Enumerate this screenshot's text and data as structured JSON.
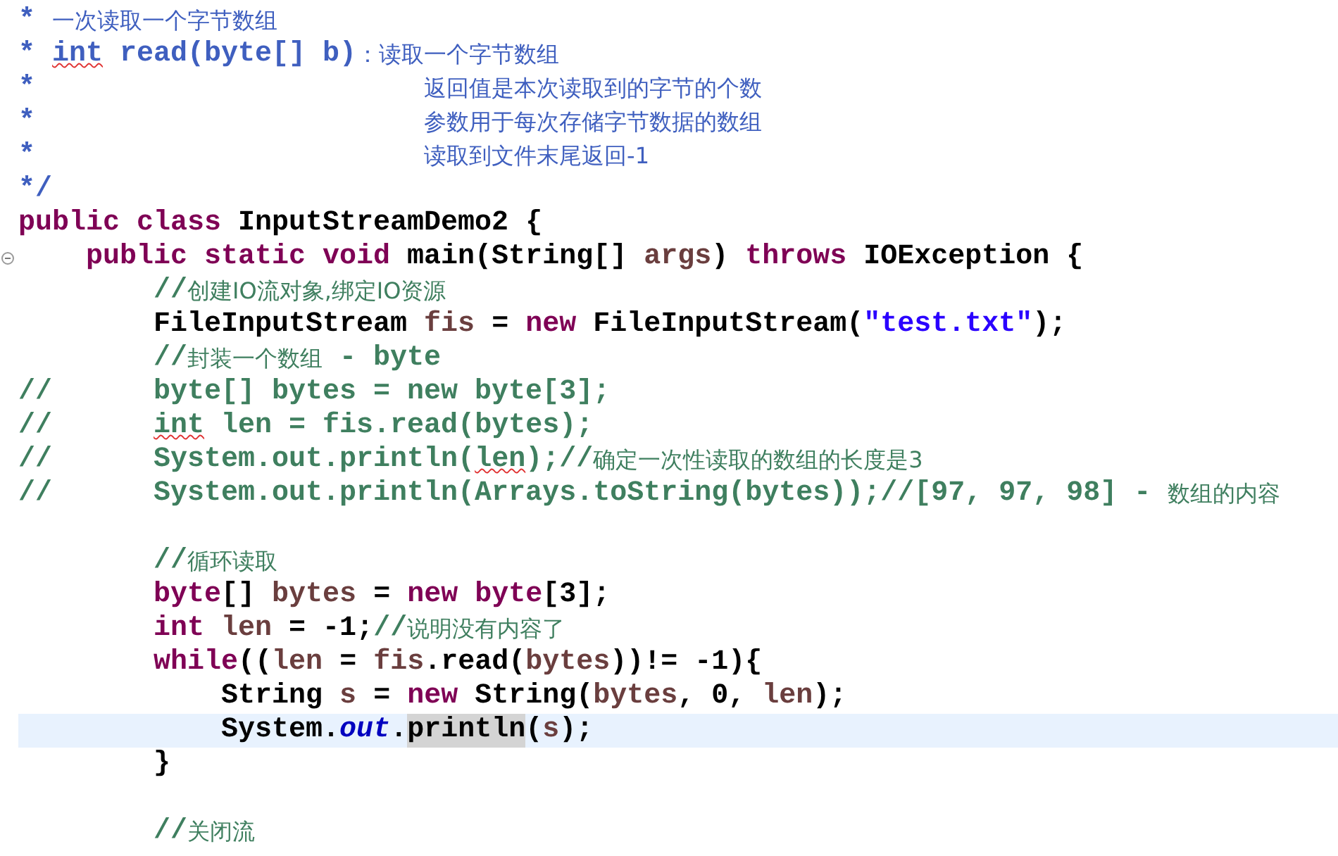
{
  "editor": {
    "lines": [
      {
        "current": false,
        "tokens": [
          {
            "kind": "doc",
            "text": "* "
          },
          {
            "kind": "docz",
            "text": "一次读取一个字节数组"
          }
        ]
      },
      {
        "current": false,
        "tokens": [
          {
            "kind": "doc",
            "text": "* "
          },
          {
            "kind": "doc",
            "text": "int",
            "squiggle": true
          },
          {
            "kind": "doc",
            "text": " read(byte[] b)"
          },
          {
            "kind": "docz",
            "text": "：读取一个字节数组"
          }
        ]
      },
      {
        "current": false,
        "tokens": [
          {
            "kind": "doc",
            "text": "*                       "
          },
          {
            "kind": "docz",
            "text": "返回值是本次读取到的字节的个数"
          }
        ]
      },
      {
        "current": false,
        "tokens": [
          {
            "kind": "doc",
            "text": "*                       "
          },
          {
            "kind": "docz",
            "text": "参数用于每次存储字节数据的数组"
          }
        ]
      },
      {
        "current": false,
        "tokens": [
          {
            "kind": "doc",
            "text": "*                       "
          },
          {
            "kind": "docz",
            "text": "读取到文件末尾返回-1"
          }
        ]
      },
      {
        "current": false,
        "tokens": [
          {
            "kind": "doc",
            "text": "*/"
          }
        ]
      },
      {
        "current": false,
        "tokens": [
          {
            "kind": "kw",
            "text": "public class "
          },
          {
            "kind": "plain",
            "text": "InputStreamDemo2 {"
          }
        ]
      },
      {
        "current": false,
        "expanded": true,
        "tokens": [
          {
            "kind": "kw",
            "text": "    public static void "
          },
          {
            "kind": "plain",
            "text": "main(String[] "
          },
          {
            "kind": "var",
            "text": "args"
          },
          {
            "kind": "plain",
            "text": ") "
          },
          {
            "kind": "kw",
            "text": "throws "
          },
          {
            "kind": "plain",
            "text": "IOException {"
          }
        ]
      },
      {
        "current": false,
        "tokens": [
          {
            "kind": "cm",
            "text": "        //"
          },
          {
            "kind": "cmz",
            "text": "创建IO流对象,绑定IO资源"
          }
        ]
      },
      {
        "current": false,
        "tokens": [
          {
            "kind": "plain",
            "text": "        FileInputStream "
          },
          {
            "kind": "var",
            "text": "fis"
          },
          {
            "kind": "plain",
            "text": " = "
          },
          {
            "kind": "kw",
            "text": "new "
          },
          {
            "kind": "plain",
            "text": "FileInputStream("
          },
          {
            "kind": "str",
            "text": "\"test.txt\""
          },
          {
            "kind": "plain",
            "text": ");"
          }
        ]
      },
      {
        "current": false,
        "tokens": [
          {
            "kind": "cm",
            "text": "        //"
          },
          {
            "kind": "cmz",
            "text": "封装一个数组"
          },
          {
            "kind": "cm",
            "text": " - byte"
          }
        ]
      },
      {
        "current": false,
        "tokens": [
          {
            "kind": "cm",
            "text": "//      byte[] bytes = new byte[3];"
          }
        ]
      },
      {
        "current": false,
        "tokens": [
          {
            "kind": "cm",
            "text": "//      "
          },
          {
            "kind": "cm",
            "text": "int",
            "squiggle": true
          },
          {
            "kind": "cm",
            "text": " len = fis.read(bytes);"
          }
        ]
      },
      {
        "current": false,
        "tokens": [
          {
            "kind": "cm",
            "text": "//      System.out.println("
          },
          {
            "kind": "cm",
            "text": "len",
            "squiggle": true
          },
          {
            "kind": "cm",
            "text": ");//"
          },
          {
            "kind": "cmz",
            "text": "确定一次性读取的数组的长度是3"
          }
        ]
      },
      {
        "current": false,
        "tokens": [
          {
            "kind": "cm",
            "text": "//      System.out.println(Arrays.toString(bytes));//[97, 97, 98] - "
          },
          {
            "kind": "cmz",
            "text": "数组的内容"
          }
        ]
      },
      {
        "current": false,
        "gap_before": true,
        "tokens": [
          {
            "kind": "cm",
            "text": "        //"
          },
          {
            "kind": "cmz",
            "text": "循环读取"
          }
        ]
      },
      {
        "current": false,
        "tokens": [
          {
            "kind": "kw",
            "text": "        byte"
          },
          {
            "kind": "plain",
            "text": "[] "
          },
          {
            "kind": "var",
            "text": "bytes"
          },
          {
            "kind": "plain",
            "text": " = "
          },
          {
            "kind": "kw",
            "text": "new byte"
          },
          {
            "kind": "plain",
            "text": "[3];"
          }
        ]
      },
      {
        "current": false,
        "tokens": [
          {
            "kind": "kw",
            "text": "        int "
          },
          {
            "kind": "var",
            "text": "len"
          },
          {
            "kind": "plain",
            "text": " = -1;"
          },
          {
            "kind": "cm",
            "text": "//"
          },
          {
            "kind": "cmz",
            "text": "说明没有内容了"
          }
        ]
      },
      {
        "current": false,
        "tokens": [
          {
            "kind": "kw",
            "text": "        while"
          },
          {
            "kind": "plain",
            "text": "(("
          },
          {
            "kind": "var",
            "text": "len"
          },
          {
            "kind": "plain",
            "text": " = "
          },
          {
            "kind": "var",
            "text": "fis"
          },
          {
            "kind": "plain",
            "text": ".read("
          },
          {
            "kind": "var",
            "text": "bytes"
          },
          {
            "kind": "plain",
            "text": "))!= -1){"
          }
        ]
      },
      {
        "current": false,
        "tokens": [
          {
            "kind": "plain",
            "text": "            String "
          },
          {
            "kind": "var",
            "text": "s"
          },
          {
            "kind": "plain",
            "text": " = "
          },
          {
            "kind": "kw",
            "text": "new "
          },
          {
            "kind": "plain",
            "text": "String("
          },
          {
            "kind": "var",
            "text": "bytes"
          },
          {
            "kind": "plain",
            "text": ", 0, "
          },
          {
            "kind": "var",
            "text": "len"
          },
          {
            "kind": "plain",
            "text": ");"
          }
        ]
      },
      {
        "current": true,
        "tokens": [
          {
            "kind": "plain",
            "text": "            System."
          },
          {
            "kind": "field",
            "text": "out"
          },
          {
            "kind": "plain",
            "text": "."
          },
          {
            "kind": "occ",
            "text": "println"
          },
          {
            "kind": "plain",
            "text": "("
          },
          {
            "kind": "var",
            "text": "s"
          },
          {
            "kind": "plain",
            "text": ");"
          }
        ]
      },
      {
        "current": false,
        "tokens": [
          {
            "kind": "plain",
            "text": "        }"
          }
        ]
      },
      {
        "current": false,
        "gap_before": true,
        "tokens": [
          {
            "kind": "cm",
            "text": "        //"
          },
          {
            "kind": "cmz",
            "text": "关闭流"
          }
        ]
      }
    ]
  }
}
